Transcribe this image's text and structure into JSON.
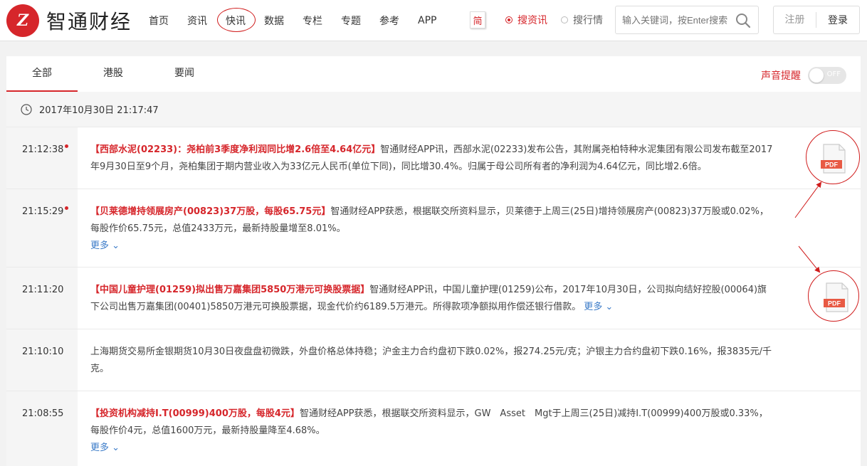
{
  "header": {
    "logo_mark": "Z",
    "logo_text": "智通财经",
    "nav": [
      "首页",
      "资讯",
      "快讯",
      "数据",
      "专栏",
      "专题",
      "参考",
      "APP"
    ],
    "lang": "简",
    "search_modes": [
      "搜资讯",
      "搜行情"
    ],
    "search_placeholder": "输入关键词，按Enter搜索",
    "register": "注册",
    "login": "登录",
    "brand_color": "#d6262b"
  },
  "tabs": [
    "全部",
    "港股",
    "要闻"
  ],
  "sound": {
    "label": "声音提醒",
    "state": "OFF"
  },
  "date_header": "2017年10月30日 21:17:47",
  "news": [
    {
      "time": "21:12:38",
      "important": true,
      "title": "【西部水泥(02233)：尧柏前3季度净利润同比增2.6倍至4.64亿元】",
      "text": "智通财经APP讯，西部水泥(02233)发布公告，其附属尧柏特种水泥集团有限公司发布截至2017年9月30日至9个月，尧柏集团于期内营业收入为33亿元人民币(单位下同)，同比增30.4%。归属于母公司所有者的净利润为4.64亿元，同比增2.6倍。",
      "more": "",
      "pdf": "PDF"
    },
    {
      "time": "21:15:29",
      "important": true,
      "title": "【贝莱德增持领展房产(00823)37万股，每股65.75元】",
      "text": "智通财经APP获悉，根据联交所资料显示，贝莱德于上周三(25日)增持领展房产(00823)37万股或0.02%，每股作价65.75元，总值2433万元，最新持股量增至8.01%。",
      "more": "更多",
      "pdf": ""
    },
    {
      "time": "21:11:20",
      "important": false,
      "title": "【中国儿童护理(01259)拟出售万嘉集团5850万港元可换股票据】",
      "text": "智通财经APP讯，中国儿童护理(01259)公布，2017年10月30日，公司拟向结好控股(00064)旗下公司出售万嘉集团(00401)5850万港元可换股票据，现金代价约6189.5万港元。所得款项净额拟用作偿还银行借款。",
      "more": "更多",
      "pdf": "PDF"
    },
    {
      "time": "21:10:10",
      "important": false,
      "title": "",
      "text": "上海期货交易所金银期货10月30日夜盘盘初微跌，外盘价格总体持稳；沪金主力合约盘初下跌0.02%，报274.25元/克；沪银主力合约盘初下跌0.16%，报3835元/千克。",
      "more": "",
      "pdf": ""
    },
    {
      "time": "21:08:55",
      "important": false,
      "title": "【投资机构减持I.T(00999)400万股，每股4元】",
      "text": "智通财经APP获悉，根据联交所资料显示，GW　Asset　Mgt于上周三(25日)减持I.T(00999)400万股或0.33%，每股作价4元，总值1600万元，最新持股量降至4.68%。",
      "more": "更多",
      "pdf": ""
    }
  ]
}
